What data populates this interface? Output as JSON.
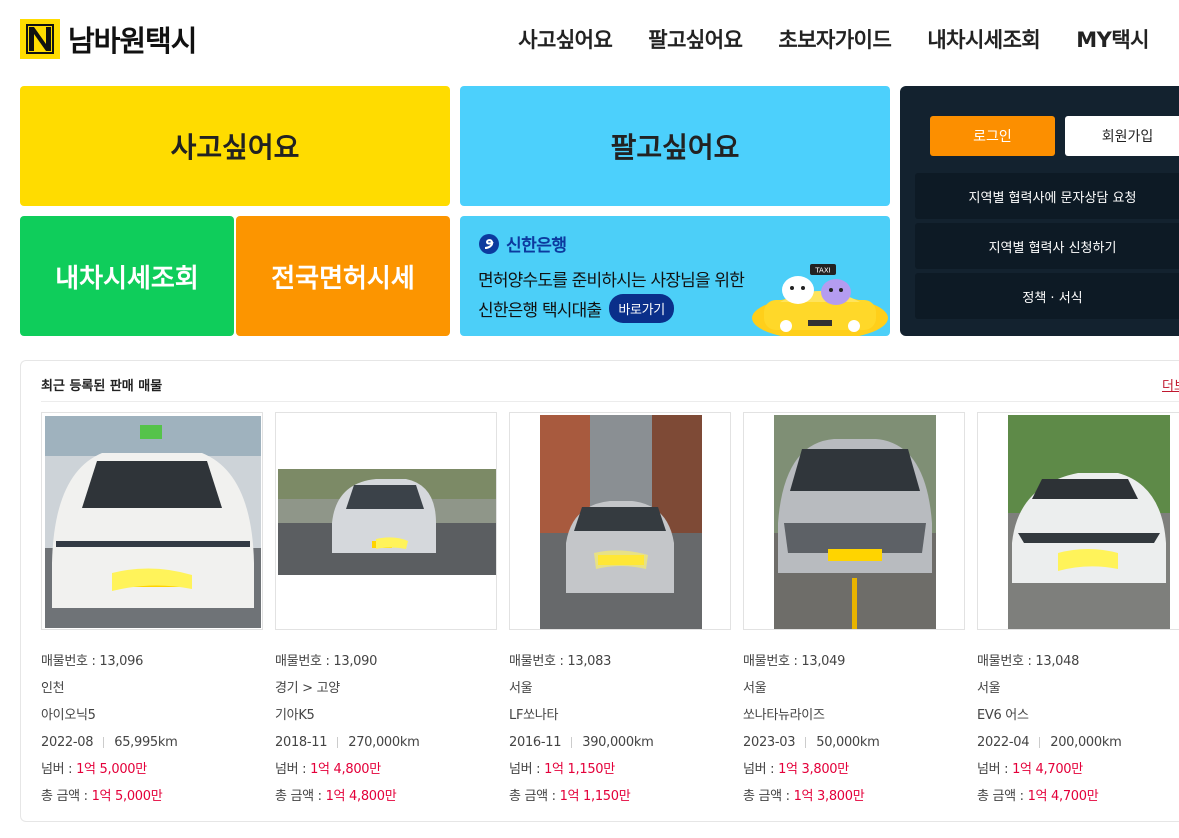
{
  "brand": {
    "name": "남바원택시"
  },
  "nav": [
    "사고싶어요",
    "팔고싶어요",
    "초보자가이드",
    "내차시세조회",
    "MY택시"
  ],
  "tiles": {
    "buy": "사고싶어요",
    "sell": "팔고싶어요",
    "price": "내차시세조회",
    "license": "전국면허시세"
  },
  "banner": {
    "bank": "신한은행",
    "line1": "면허양수도를 준비하시는 사장님을 위한",
    "line2": "신한은행 택시대출",
    "button": "바로가기",
    "taxi_sign": "TAXI"
  },
  "side": {
    "login": "로그인",
    "join": "회원가입",
    "links": [
      "지역별 협력사에 문자상담 요청",
      "지역별 협력사 신청하기",
      "정책 · 서식"
    ]
  },
  "listings": {
    "title": "최근 등록된 판매 매물",
    "more": "더보",
    "items": [
      {
        "id": "매물번호 : 13,096",
        "region": "인천",
        "model": "아이오닉5",
        "date": "2022-08",
        "km": "65,995km",
        "numlabel": "넘버 : ",
        "num": "1억 5,000만",
        "totallabel": "총 금액 : ",
        "total": "1억 5,000만"
      },
      {
        "id": "매물번호 : 13,090",
        "region": "경기 > 고양",
        "model": "기아K5",
        "date": "2018-11",
        "km": "270,000km",
        "numlabel": "넘버 : ",
        "num": "1억 4,800만",
        "totallabel": "총 금액 : ",
        "total": "1억 4,800만"
      },
      {
        "id": "매물번호 : 13,083",
        "region": "서울",
        "model": "LF쏘나타",
        "date": "2016-11",
        "km": "390,000km",
        "numlabel": "넘버 : ",
        "num": "1억 1,150만",
        "totallabel": "총 금액 : ",
        "total": "1억 1,150만"
      },
      {
        "id": "매물번호 : 13,049",
        "region": "서울",
        "model": "쏘나타뉴라이즈",
        "date": "2023-03",
        "km": "50,000km",
        "numlabel": "넘버 : ",
        "num": "1억 3,800만",
        "totallabel": "총 금액 : ",
        "total": "1억 3,800만"
      },
      {
        "id": "매물번호 : 13,048",
        "region": "서울",
        "model": "EV6 어스",
        "date": "2022-04",
        "km": "200,000km",
        "numlabel": "넘버 : ",
        "num": "1억 4,700만",
        "totallabel": "총 금액 : ",
        "total": "1억 4,700만"
      }
    ]
  },
  "colors": {
    "yellow": "#ffdc00",
    "sky": "#4cd0fc",
    "green": "#0fcd5b",
    "orange": "#fc9500",
    "panel": "#13222f",
    "price_red": "#e4003a"
  }
}
